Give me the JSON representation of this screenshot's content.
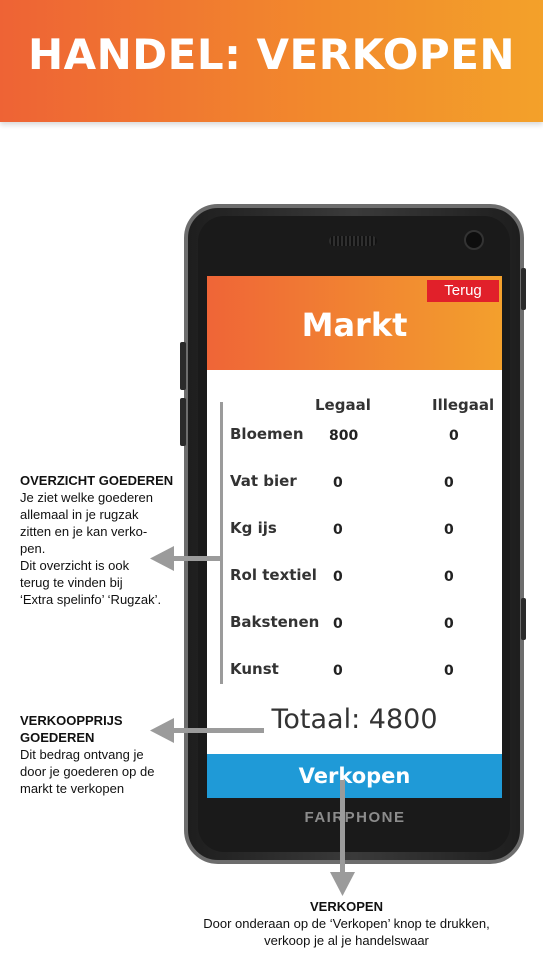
{
  "header": {
    "title": "HANDEL: VERKOPEN"
  },
  "phone": {
    "brand": "FAIRPHONE"
  },
  "screen": {
    "back_label": "Terug",
    "title": "Markt",
    "columns": {
      "legal": "Legaal",
      "illegal": "Illegaal"
    },
    "rows": [
      {
        "name": "Bloemen",
        "legal": "800",
        "illegal": "0"
      },
      {
        "name": "Vat bier",
        "legal": "0",
        "illegal": "0"
      },
      {
        "name": "Kg ijs",
        "legal": "0",
        "illegal": "0"
      },
      {
        "name": "Rol textiel",
        "legal": "0",
        "illegal": "0"
      },
      {
        "name": "Bakstenen",
        "legal": "0",
        "illegal": "0"
      },
      {
        "name": "Kunst",
        "legal": "0",
        "illegal": "0"
      }
    ],
    "total": "Totaal: 4800",
    "sell_label": "Verkopen"
  },
  "annotations": {
    "overview": {
      "title": "OVERZICHT GOEDEREN",
      "lines": [
        "Je ziet welke goederen",
        "allemaal in je rugzak",
        "zitten en je kan verko-",
        "pen.",
        "Dit overzicht is ook",
        "terug te vinden bij",
        "‘Extra spelinfo’ ‘Rugzak’."
      ]
    },
    "price": {
      "title_lines": [
        "VERKOOPPRIJS",
        "GOEDEREN"
      ],
      "lines": [
        "Dit bedrag ontvang je",
        "door je goederen op de",
        "markt te verkopen"
      ]
    },
    "sell": {
      "title": "VERKOPEN",
      "lines": [
        "Door onderaan op  de ‘Verkopen’ knop te drukken,",
        "verkoop je al je handelswaar"
      ]
    }
  },
  "colors": {
    "orange_start": "#ee6335",
    "orange_end": "#f3a12a",
    "back_red": "#e1202a",
    "sell_blue": "#1f9ad7",
    "arrow_gray": "#9b9b9b"
  }
}
